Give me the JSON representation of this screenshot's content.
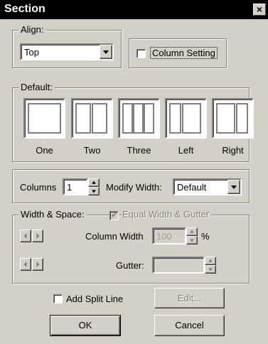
{
  "window": {
    "title": "Section",
    "close_glyph": "×"
  },
  "align": {
    "legend": "Align:",
    "selected": "Top",
    "column_setting_label": "Column Setting",
    "column_setting_checked": false
  },
  "default": {
    "legend": "Default:",
    "presets": [
      {
        "label": "One"
      },
      {
        "label": "Two"
      },
      {
        "label": "Three"
      },
      {
        "label": "Left"
      },
      {
        "label": "Right"
      }
    ]
  },
  "columns": {
    "columns_label": "Columns",
    "columns_value": "1",
    "modify_width_label": "Modify Width:",
    "modify_width_selected": "Default"
  },
  "width_space": {
    "legend": "Width & Space:",
    "equal_label": "Equal Width & Gutter",
    "equal_checked": true,
    "column_width_label": "Column Width",
    "column_width_value": "100",
    "percent_label": "%",
    "gutter_label": "Gutter:",
    "gutter_value": ""
  },
  "bottom": {
    "split_line_label": "Add Split Line",
    "split_line_checked": false,
    "edit_label": "Edit...",
    "ok_label": "OK",
    "cancel_label": "Cancel"
  },
  "colors": {
    "face": "#d4d0c8",
    "titlebar": "#000000",
    "disabled_text": "#808080"
  },
  "icons": [
    "close-icon",
    "dropdown-arrow-icon",
    "spin-up-icon",
    "spin-down-icon",
    "arrow-left-icon",
    "arrow-right-icon",
    "checkmark-icon"
  ]
}
